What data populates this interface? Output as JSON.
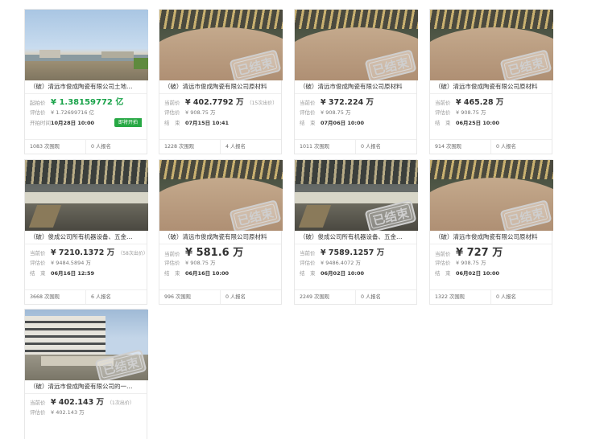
{
  "cards": [
    {
      "title": "（破）清远市俊成陶瓷有限公司土地…",
      "r1_label": "起拍价",
      "r1_value": "¥ 1.38159772 亿",
      "r2_label": "评估价",
      "r2_value": "¥ 1.72699716 亿",
      "r3_label": "开拍时间",
      "r3_value": "10月28日 10:00",
      "badge": "即将开拍",
      "views": "1083 次围观",
      "signups": "0 人报名"
    },
    {
      "title": "（破）清远市俊成陶瓷有限公司原材料",
      "r1_label": "当前价",
      "r1_value": "¥ 402.7792 万",
      "r1_tag": "（15次出价）",
      "r2_label": "评估价",
      "r2_value": "¥ 908.75 万",
      "r3_label": "结　束",
      "r3_value": "07月15日 10:41",
      "stamp": "已结束",
      "views": "1228 次围观",
      "signups": "4 人报名"
    },
    {
      "title": "（破）清远市俊成陶瓷有限公司原材料",
      "r1_label": "当前价",
      "r1_value": "¥ 372.224 万",
      "r2_label": "评估价",
      "r2_value": "¥ 908.75 万",
      "r3_label": "结　束",
      "r3_value": "07月06日 10:00",
      "stamp": "已结束",
      "views": "1011 次围观",
      "signups": "0 人报名"
    },
    {
      "title": "（破）清远市俊成陶瓷有限公司原材料",
      "r1_label": "当前价",
      "r1_value": "¥ 465.28 万",
      "r2_label": "评估价",
      "r2_value": "¥ 908.75 万",
      "r3_label": "结　束",
      "r3_value": "06月25日 10:00",
      "stamp": "已结束",
      "views": "914 次围观",
      "signups": "0 人报名"
    },
    {
      "title": "（破）俊成公司所有机器设备、五金…",
      "r1_label": "当前价",
      "r1_value": "¥ 7210.1372 万",
      "r1_tag": "（58次出价）",
      "r2_label": "评估价",
      "r2_value": "¥ 9484.5894 万",
      "r3_label": "结　束",
      "r3_value": "06月16日 12:59",
      "views": "3668 次围观",
      "signups": "6 人报名"
    },
    {
      "title": "（破）清远市俊成陶瓷有限公司原材料",
      "r1_label": "当前价",
      "r1_value": "¥ 581.6 万",
      "r2_label": "评估价",
      "r2_value": "¥ 908.75 万",
      "r3_label": "结　束",
      "r3_value": "06月16日 10:00",
      "stamp": "已结束",
      "views": "996 次围观",
      "signups": "0 人报名"
    },
    {
      "title": "（破）俊成公司所有机器设备、五金…",
      "r1_label": "当前价",
      "r1_value": "¥ 7589.1257 万",
      "r2_label": "评估价",
      "r2_value": "¥ 9486.4072 万",
      "r3_label": "结　束",
      "r3_value": "06月02日 10:00",
      "stamp": "已结束",
      "views": "2249 次围观",
      "signups": "0 人报名"
    },
    {
      "title": "（破）清远市俊成陶瓷有限公司原材料",
      "r1_label": "当前价",
      "r1_value": "¥ 727 万",
      "r2_label": "评估价",
      "r2_value": "¥ 908.75 万",
      "r3_label": "结　束",
      "r3_value": "06月02日 10:00",
      "stamp": "已结束",
      "views": "1322 次围观",
      "signups": "0 人报名"
    },
    {
      "title": "（破）清远市俊成陶瓷有限公司的一…",
      "r1_label": "当前价",
      "r1_value": "¥ 402.143 万",
      "r1_tag": "（1次出价）",
      "r2_label": "评估价",
      "r2_value": "¥ 402.143 万",
      "stamp": "已结束"
    }
  ],
  "colors": {
    "green": "#1aa34a",
    "badge": "#27a844",
    "stamp": "#cfcfcf"
  }
}
